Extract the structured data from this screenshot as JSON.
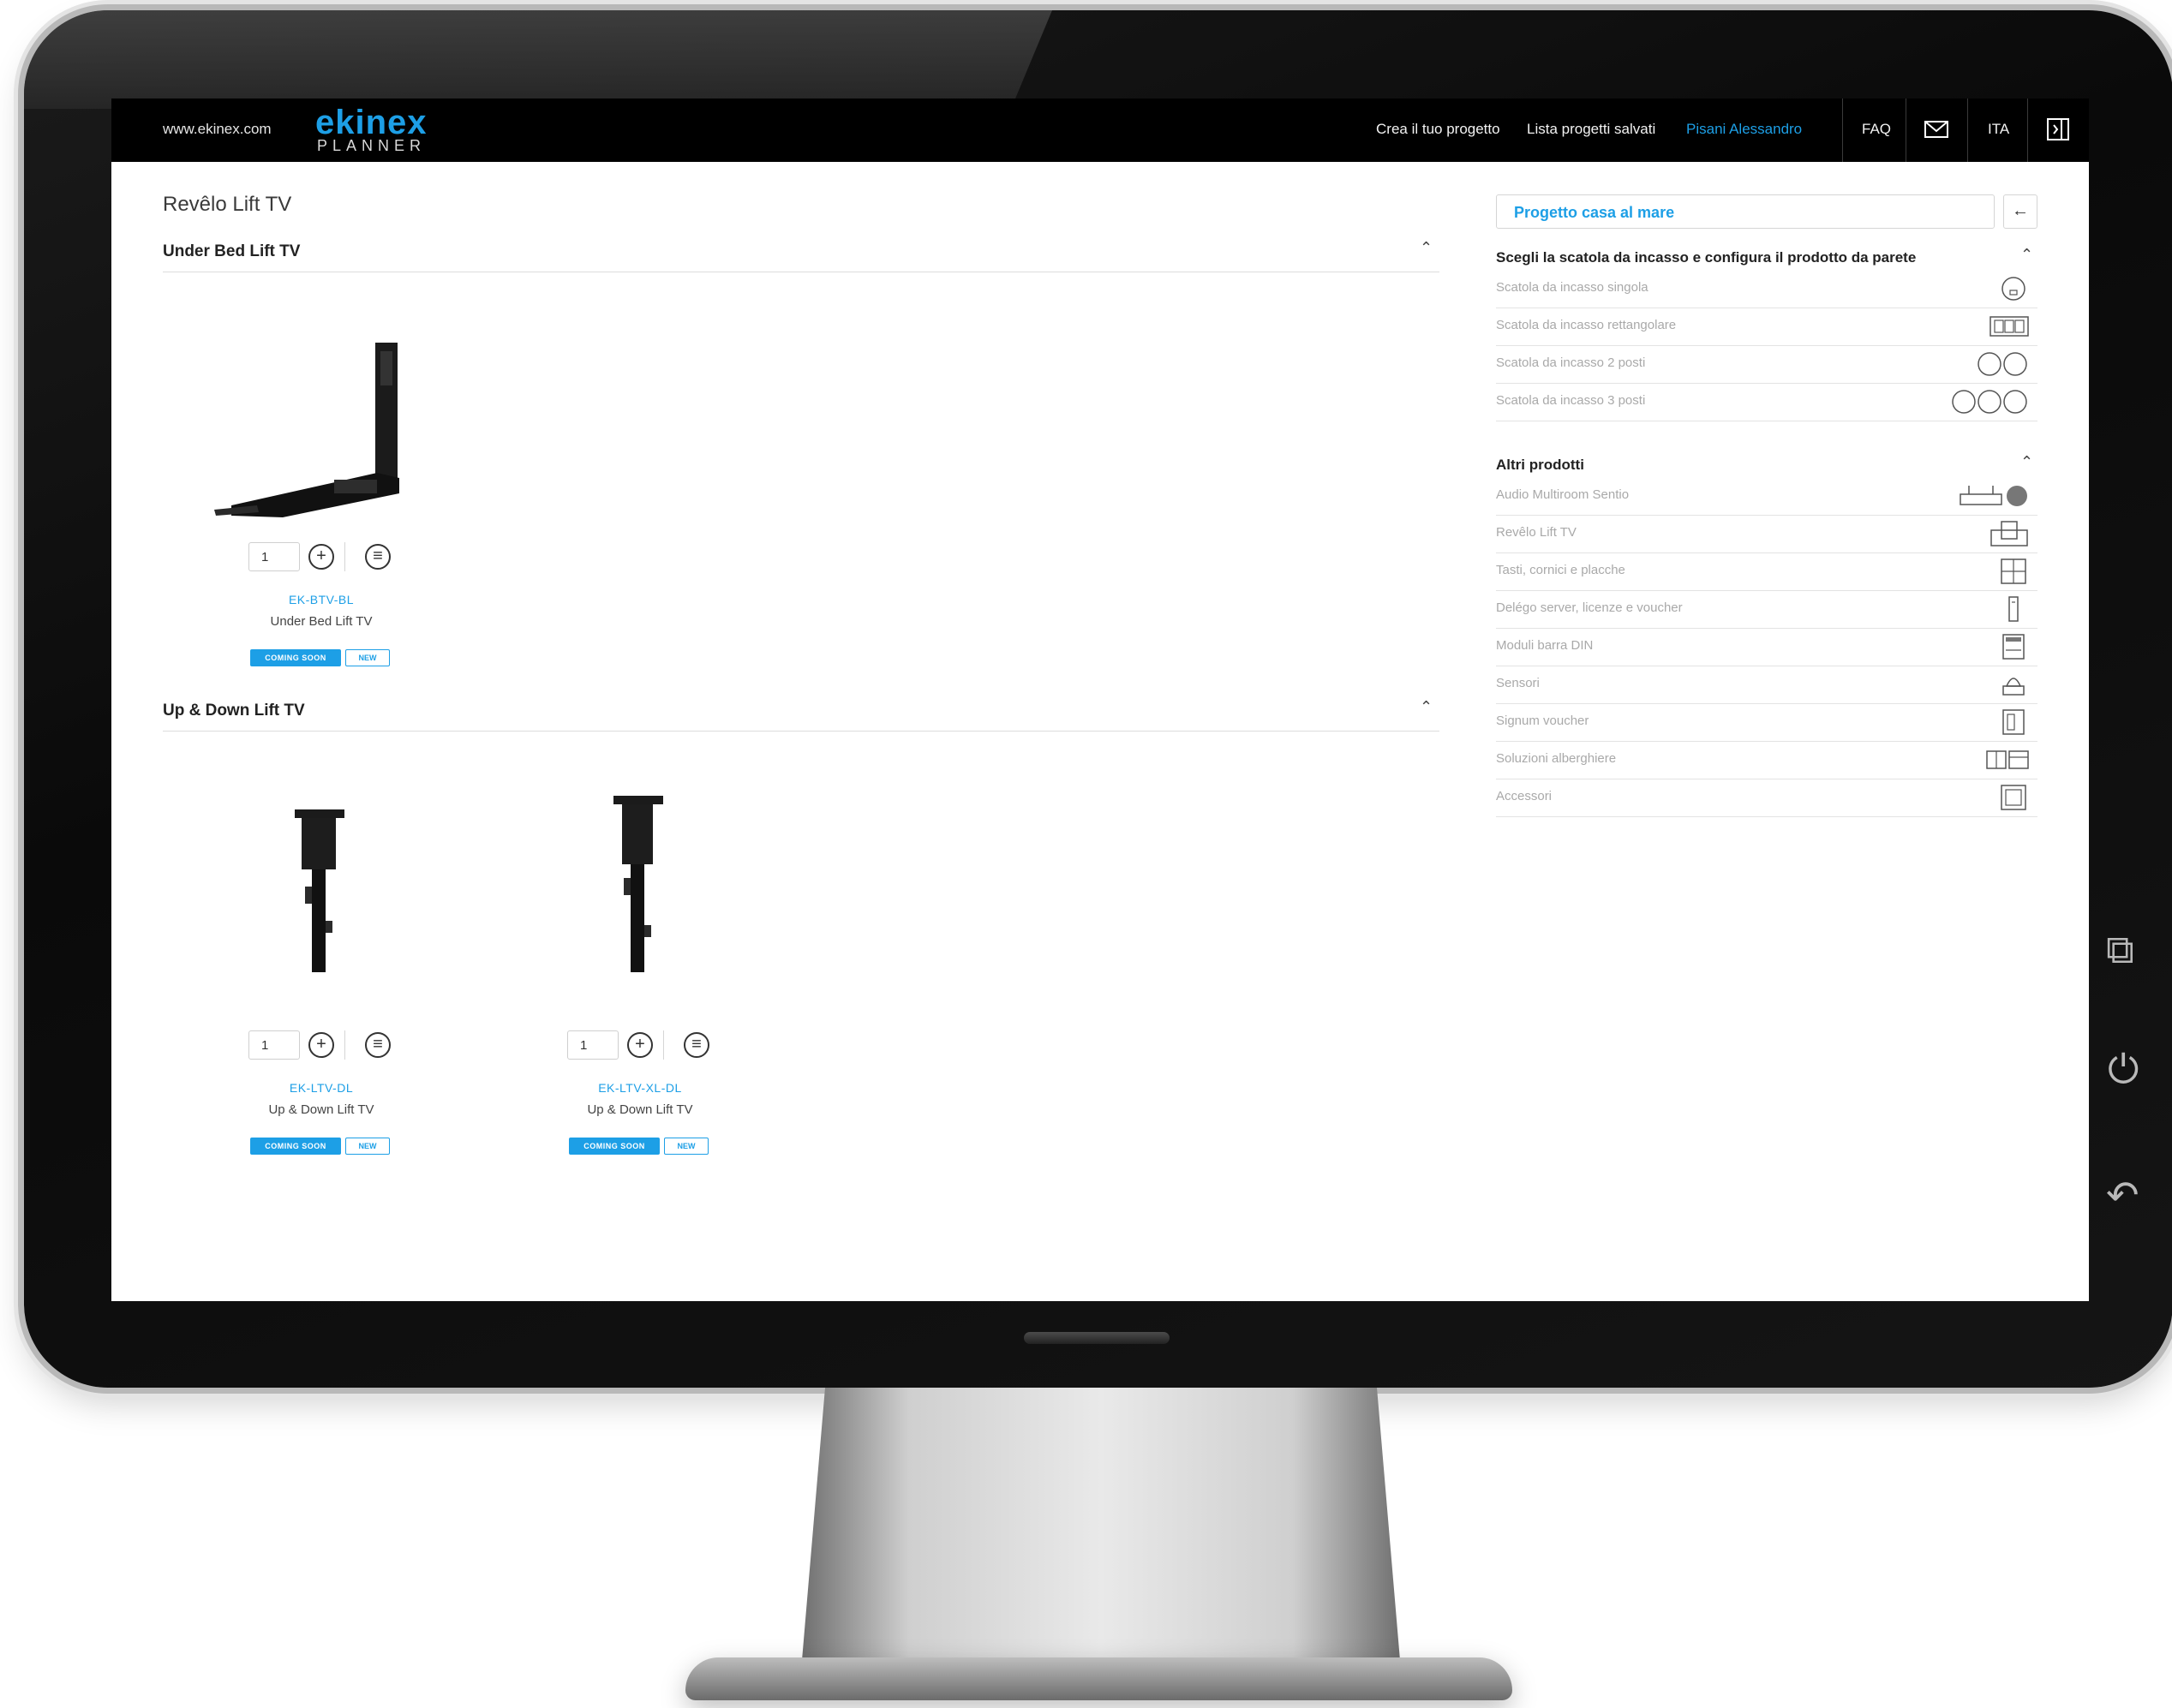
{
  "header": {
    "site_link": "www.ekinex.com",
    "logo_brand": "ekinex",
    "logo_sub": "PLANNER",
    "nav": {
      "create": "Crea il tuo progetto",
      "saved": "Lista progetti salvati",
      "user": "Pisani Alessandro",
      "faq": "FAQ",
      "lang": "ITA"
    }
  },
  "main": {
    "page_title": "Revêlo Lift TV",
    "sections": [
      {
        "title": "Under Bed Lift TV",
        "products": [
          {
            "qty": "1",
            "code": "EK-BTV-BL",
            "name": "Under Bed Lift TV",
            "badge_soon": "COMING SOON",
            "badge_new": "NEW"
          }
        ]
      },
      {
        "title": "Up & Down Lift TV",
        "products": [
          {
            "qty": "1",
            "code": "EK-LTV-DL",
            "name": "Up & Down Lift TV",
            "badge_soon": "COMING SOON",
            "badge_new": "NEW"
          },
          {
            "qty": "1",
            "code": "EK-LTV-XL-DL",
            "name": "Up & Down Lift TV",
            "badge_soon": "COMING SOON",
            "badge_new": "NEW"
          }
        ]
      }
    ]
  },
  "panel": {
    "project_name": "Progetto casa al mare",
    "box_title": "Scegli la scatola da incasso e configura il prodotto da parete",
    "boxes": [
      {
        "label": "Scatola da incasso singola",
        "icon": "single-box-icon"
      },
      {
        "label": "Scatola da incasso rettangolare",
        "icon": "rectangular-box-icon"
      },
      {
        "label": "Scatola da incasso 2 posti",
        "icon": "double-box-icon"
      },
      {
        "label": "Scatola da incasso 3 posti",
        "icon": "triple-box-icon"
      }
    ],
    "other_title": "Altri prodotti",
    "others": [
      {
        "label": "Audio Multiroom Sentio",
        "icon": "audio-multiroom-icon"
      },
      {
        "label": "Revêlo Lift TV",
        "icon": "lift-tv-icon"
      },
      {
        "label": "Tasti, cornici e placche",
        "icon": "keys-plates-icon"
      },
      {
        "label": "Delégo server, licenze e voucher",
        "icon": "server-icon"
      },
      {
        "label": "Moduli barra DIN",
        "icon": "din-module-icon"
      },
      {
        "label": "Sensori",
        "icon": "sensor-icon"
      },
      {
        "label": "Signum voucher",
        "icon": "voucher-icon"
      },
      {
        "label": "Soluzioni alberghiere",
        "icon": "hotel-icon"
      },
      {
        "label": "Accessori",
        "icon": "accessories-icon"
      }
    ]
  },
  "colors": {
    "accent": "#1d9fe6",
    "topbar": "#000000",
    "muted_text": "#a9a9a9"
  }
}
